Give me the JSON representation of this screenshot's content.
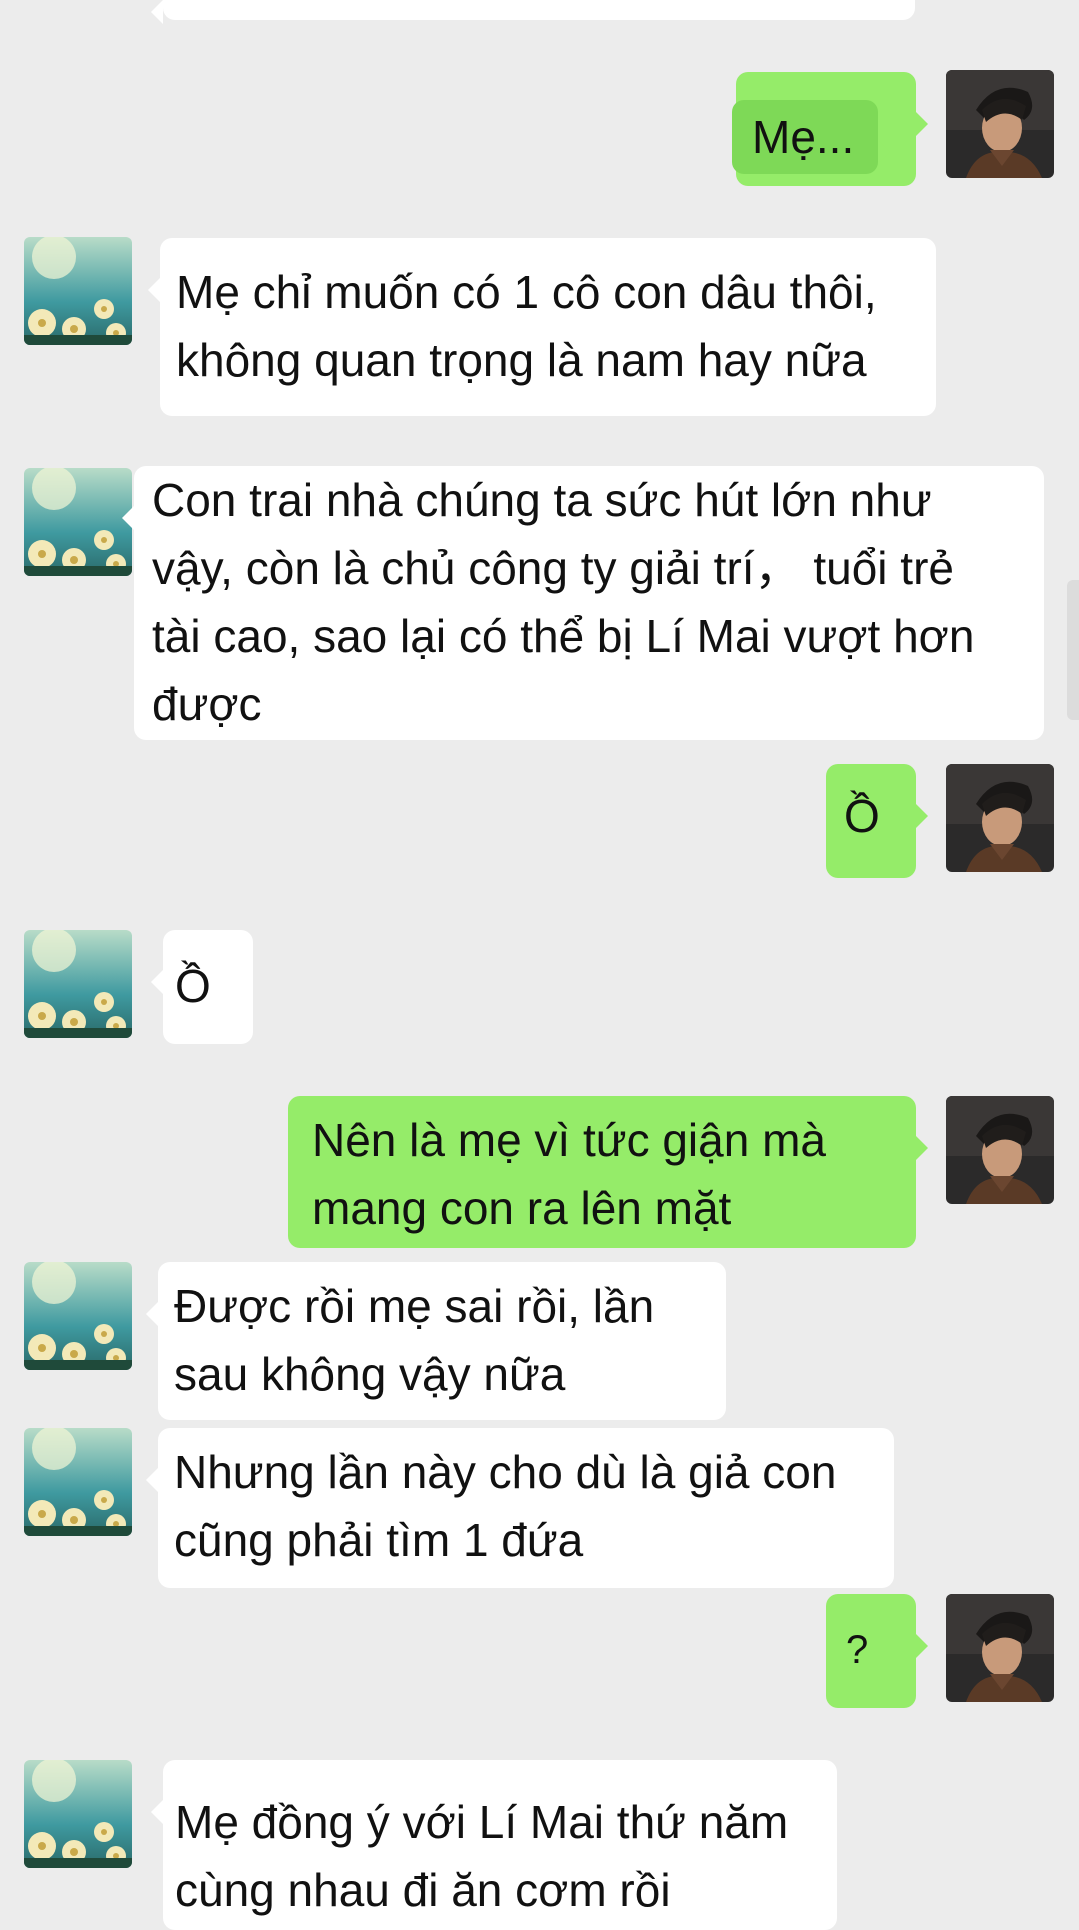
{
  "messages": [
    {
      "side": "out",
      "text": "Mẹ..."
    },
    {
      "side": "in",
      "text": "Mẹ chỉ muốn có 1 cô con dâu thôi,\nkhông quan trọng là nam hay nữa"
    },
    {
      "side": "in",
      "text": "Con trai nhà chúng ta sức hút lớn như\nvậy, còn là chủ công ty giải trí，  tuổi trẻ\ntài cao, sao lại có thể bị Lí Mai vượt hơn\nđược"
    },
    {
      "side": "out",
      "text": "Ồ"
    },
    {
      "side": "in",
      "text": "Ồ"
    },
    {
      "side": "out",
      "text": "Nên là mẹ vì tức giận mà\nmang con ra lên mặt"
    },
    {
      "side": "in",
      "text": "Được rồi mẹ sai rồi, lần\nsau không vậy nữa"
    },
    {
      "side": "in",
      "text": "Nhưng lần này cho dù là giả con\ncũng phải tìm 1 đứa"
    },
    {
      "side": "out",
      "text": "?"
    },
    {
      "side": "in",
      "text": "Mẹ đồng ý với Lí Mai thứ năm\ncùng nhau đi ăn cơm rồi"
    }
  ]
}
